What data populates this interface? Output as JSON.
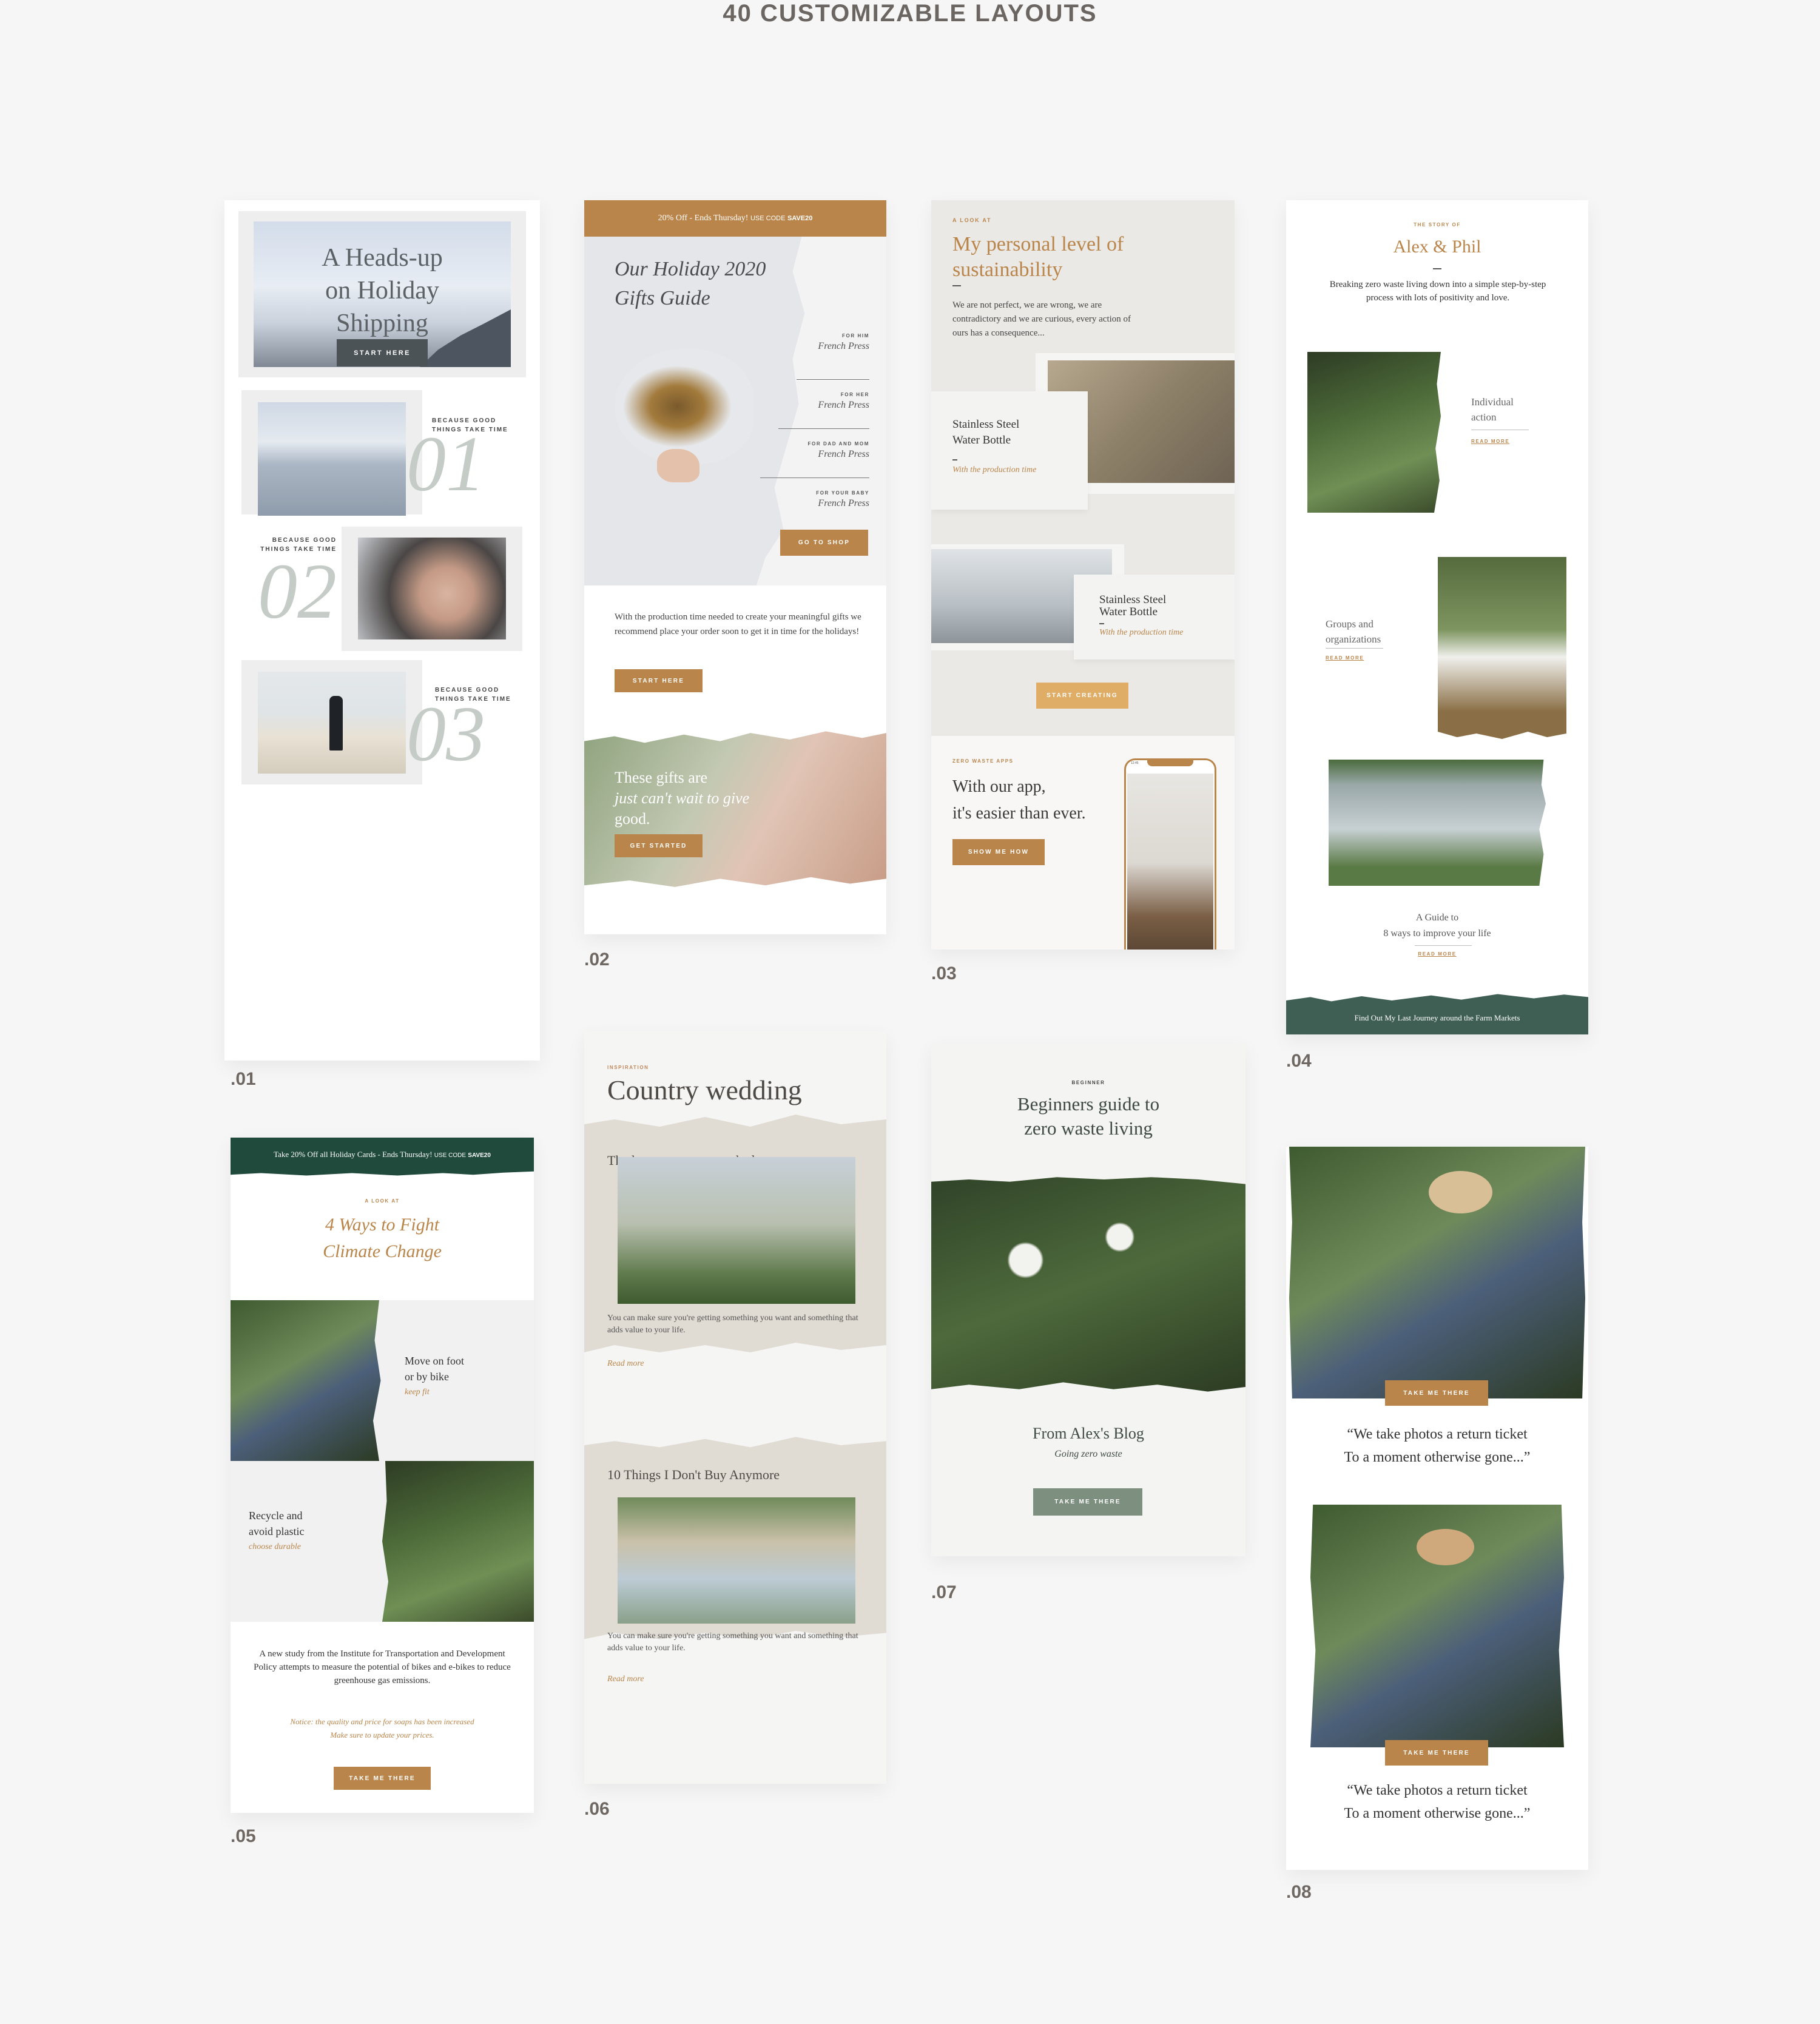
{
  "page": {
    "title": "40 CUSTOMIZABLE LAYOUTS",
    "background": "#f6f6f6",
    "accent": "#b9854a",
    "green": "#3f5f55",
    "sage": "#7d9080"
  },
  "layouts": [
    {
      "number": ".01",
      "hero": {
        "title_lines": [
          "A Heads-up",
          "on Holiday",
          "Shipping"
        ],
        "button": "START HERE"
      },
      "items": [
        {
          "kicker_lines": [
            "BECAUSE GOOD",
            "THINGS TAKE TIME"
          ],
          "numeral": "01"
        },
        {
          "kicker_lines": [
            "BECAUSE GOOD",
            "THINGS TAKE TIME"
          ],
          "numeral": "02"
        },
        {
          "kicker_lines": [
            "BECAUSE GOOD",
            "THINGS TAKE TIME"
          ],
          "numeral": "03"
        }
      ]
    },
    {
      "number": ".02",
      "banner": {
        "text": "20% Off  - Ends Thursday!",
        "code_prefix": "USE CODE",
        "code": "SAVE20"
      },
      "hero_title_lines": [
        "Our Holiday 2020",
        "Gifts Guide"
      ],
      "gift_list": [
        {
          "label": "FOR HIM",
          "item": "French Press"
        },
        {
          "label": "FOR HER",
          "item": "French Press"
        },
        {
          "label": "FOR DAD AND MOM",
          "item": "French Press"
        },
        {
          "label": "FOR YOUR BABY",
          "item": "French Press"
        }
      ],
      "shop_button": "GO TO SHOP",
      "body": "With the production time needed to create your meaningful gifts we recommend place your order soon to get it in time for the holidays!",
      "start_button": "START HERE",
      "promo": {
        "line1": "These gifts are",
        "line2": "just can't wait to give",
        "line3": "good.",
        "button": "GET STARTED"
      }
    },
    {
      "number": ".03",
      "kicker": "A LOOK AT",
      "title": "My personal level of sustainability",
      "body": "We are not perfect, we are wrong, we are contradictory and we are curious, every action of ours has a consequence...",
      "products": [
        {
          "name_lines": [
            "Stainless Steel",
            "Water Bottle"
          ],
          "note": "With the production time"
        },
        {
          "name_lines": [
            "Stainless Steel",
            "Water Bottle"
          ],
          "note": "With the production time"
        }
      ],
      "create_button": "START CREATING",
      "app": {
        "kicker": "ZERO WASTE APPS",
        "title_lines": [
          "With our app,",
          "it's easier than ever."
        ],
        "button": "SHOW ME HOW",
        "phone_time": "12:45"
      }
    },
    {
      "number": ".04",
      "kicker": "THE STORY OF",
      "title": "Alex & Phil",
      "intro": "Breaking zero waste living down into a simple step-by-step process with lots of positivity and love.",
      "features": [
        {
          "title_lines": [
            "Individual",
            "action"
          ],
          "link": "READ MORE"
        },
        {
          "title_lines": [
            "Groups and",
            "organizations"
          ],
          "link": "READ MORE"
        }
      ],
      "guide": {
        "title_lines": [
          "A Guide to",
          "8 ways to improve your life"
        ],
        "link": "READ MORE"
      },
      "footer": "Find Out My Last Journey around the Farm Markets"
    },
    {
      "number": ".05",
      "banner": {
        "text": "Take 20% Off all Holiday Cards - Ends Thursday!",
        "code_prefix": "USE CODE",
        "code": "SAVE20"
      },
      "kicker": "A LOOK AT",
      "title_lines": [
        "4 Ways to Fight",
        "Climate Change"
      ],
      "tips": [
        {
          "title_lines": [
            "Move on foot",
            "or by bike"
          ],
          "note": "keep fit"
        },
        {
          "title_lines": [
            "Recycle and",
            "avoid plastic"
          ],
          "note": "choose durable"
        }
      ],
      "body": "A new study from the Institute for Transportation and Development Policy attempts to measure the potential of bikes and e-bikes to reduce greenhouse gas emissions.",
      "notice_lines": [
        "Notice: the quality and price for soaps has been increased",
        "Make sure to update your prices."
      ],
      "button": "TAKE ME THERE"
    },
    {
      "number": ".06",
      "kicker": "INSPIRATION",
      "title": "Country wedding",
      "articles": [
        {
          "heading": "The less you consume, the better.",
          "body": "You can make sure you're getting something you want and something that adds value to your life.",
          "link": "Read more"
        },
        {
          "heading": "10 Things I Don't Buy Anymore",
          "body": "You can make sure you're getting something you want and something that adds value to your life.",
          "link": "Read more"
        }
      ]
    },
    {
      "number": ".07",
      "kicker": "BEGINNER",
      "title_lines": [
        "Beginners guide to",
        "zero waste living"
      ],
      "blog_title": "From Alex's Blog",
      "blog_subtitle": "Going zero waste",
      "button": "TAKE ME THERE"
    },
    {
      "number": ".08",
      "blocks": [
        {
          "button": "TAKE ME THERE",
          "quote_lines": [
            "“We take photos a return ticket",
            "To a moment otherwise gone...”"
          ]
        },
        {
          "button": "TAKE ME THERE",
          "quote_lines": [
            "“We take photos a return ticket",
            "To a moment otherwise gone...”"
          ]
        }
      ]
    }
  ]
}
